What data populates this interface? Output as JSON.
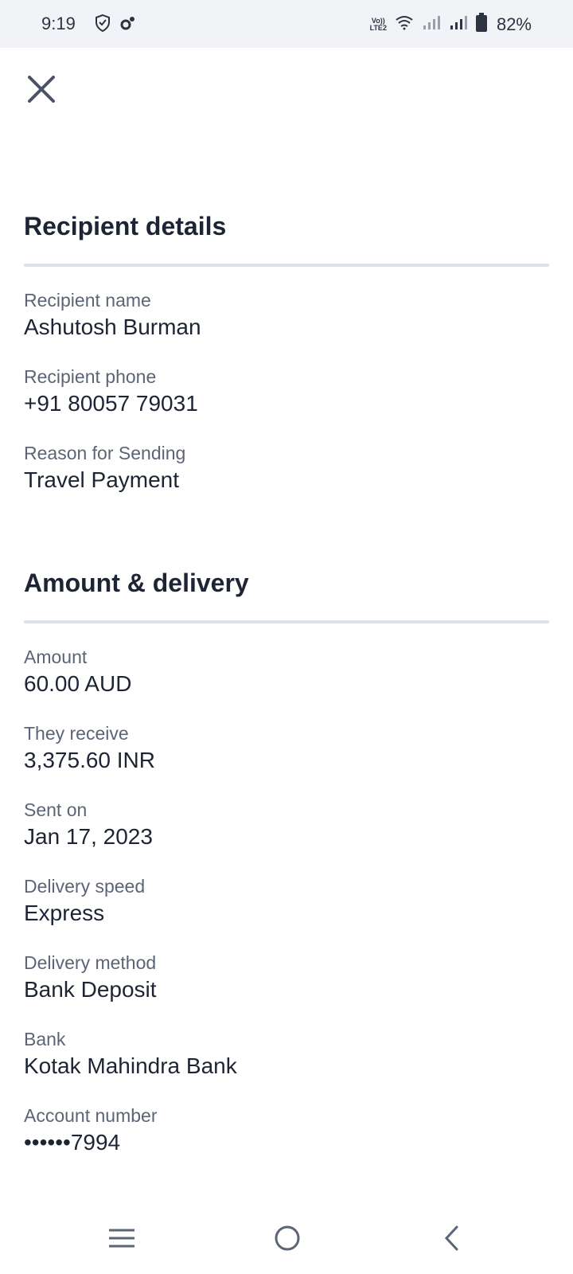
{
  "status_bar": {
    "time": "9:19",
    "network_label": "Vo))\nLTE2",
    "battery_percent": "82%"
  },
  "icons": {
    "close": "close-icon",
    "shield": "shield-icon",
    "settings": "gear-icon",
    "wifi": "wifi-icon",
    "signal": "signal-icon",
    "battery": "battery-icon",
    "menu": "recent-apps-icon",
    "home": "home-icon",
    "back": "back-icon"
  },
  "recipient": {
    "title": "Recipient details",
    "fields": [
      {
        "label": "Recipient name",
        "value": "Ashutosh Burman"
      },
      {
        "label": "Recipient phone",
        "value": "+91 80057 79031"
      },
      {
        "label": "Reason for Sending",
        "value": "Travel Payment"
      }
    ]
  },
  "amount": {
    "title": "Amount & delivery",
    "fields": [
      {
        "label": "Amount",
        "value": "60.00 AUD"
      },
      {
        "label": "They receive",
        "value": "3,375.60 INR"
      },
      {
        "label": "Sent on",
        "value": "Jan 17, 2023"
      },
      {
        "label": "Delivery speed",
        "value": "Express"
      },
      {
        "label": "Delivery method",
        "value": "Bank Deposit"
      },
      {
        "label": "Bank",
        "value": "Kotak Mahindra Bank"
      },
      {
        "label": "Account number",
        "value": "••••••7994"
      }
    ]
  },
  "colors": {
    "text_primary": "#1d2433",
    "text_secondary": "#5b6576",
    "divider": "#dde1e8",
    "status_bar_bg": "#f1f3f7"
  }
}
